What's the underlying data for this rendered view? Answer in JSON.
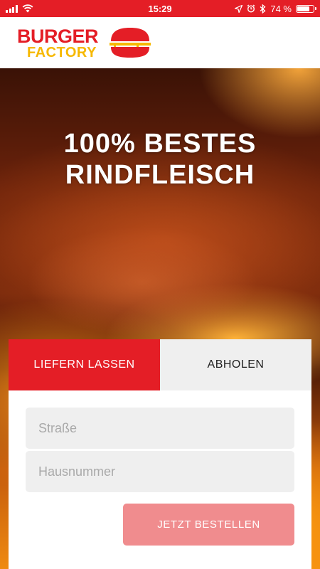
{
  "status_bar": {
    "time": "15:29",
    "battery_percent_label": "74 %",
    "battery_level": 0.74,
    "icons": [
      "signal-icon",
      "wifi-icon",
      "location-arrow-icon",
      "alarm-icon",
      "bluetooth-icon",
      "battery-icon"
    ]
  },
  "header": {
    "logo_word1": "BURGER",
    "logo_word2": "FACTORY",
    "logo_icon": "burger-icon"
  },
  "hero": {
    "title_line1": "100% BESTES",
    "title_line2": "RINDFLEISCH"
  },
  "order": {
    "tabs": [
      {
        "label": "LIEFERN LASSEN",
        "active": true
      },
      {
        "label": "ABHOLEN",
        "active": false
      }
    ],
    "street_placeholder": "Straße",
    "street_value": "",
    "number_placeholder": "Hausnummer",
    "number_value": "",
    "submit_label": "JETZT BESTELLEN"
  },
  "colors": {
    "brand_red": "#e41e26",
    "brand_yellow": "#f6b800",
    "button_disabled": "#f08c8e",
    "input_bg": "#efefef"
  }
}
